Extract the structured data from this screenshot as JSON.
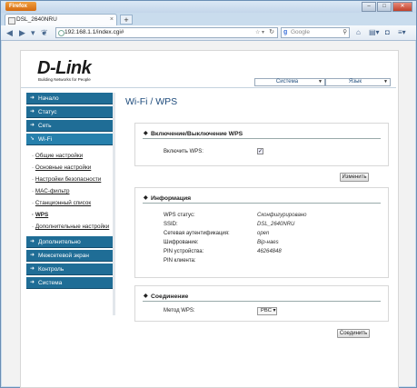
{
  "browser": {
    "app_button": "Firefox",
    "tab_title": "DSL_2640NRU",
    "tab_close": "×",
    "new_tab": "+",
    "url": "192.168.1.1/index.cgi#",
    "search_placeholder": "Google",
    "win_minimize": "–",
    "win_maximize": "□",
    "win_close": "✕"
  },
  "header": {
    "logo_text": "D-Link",
    "logo_tagline": "Building Networks for People",
    "system_select": "Система",
    "language_select": "Язык"
  },
  "sidebar": {
    "items_top": [
      {
        "label": "Начало"
      },
      {
        "label": "Статус"
      },
      {
        "label": "Сеть"
      },
      {
        "label": "Wi-Fi"
      }
    ],
    "wifi_sub": [
      {
        "label": "Общие настройки"
      },
      {
        "label": "Основные настройки"
      },
      {
        "label": "Настройки безопасности"
      },
      {
        "label": "MAC-фильтр"
      },
      {
        "label": "Станционный список"
      },
      {
        "label": "WPS"
      },
      {
        "label": "Дополнительные настройки"
      }
    ],
    "items_bottom": [
      {
        "label": "Дополнительно"
      },
      {
        "label": "Межсетевой экран"
      },
      {
        "label": "Контроль"
      },
      {
        "label": "Система"
      }
    ]
  },
  "main": {
    "title": "Wi-Fi / WPS",
    "enable_section": {
      "heading": "Включение/Выключение WPS",
      "enable_label": "Включить WPS:",
      "enable_checked": true
    },
    "apply_button": "Изменить",
    "info_section": {
      "heading": "Информация",
      "rows": [
        {
          "label": "WPS статус:",
          "value": "Сконфигурировано"
        },
        {
          "label": "SSID:",
          "value": "DSL_2640NRU"
        },
        {
          "label": "Сетевая аутентификация:",
          "value": "open"
        },
        {
          "label": "Шифрование:",
          "value": "Bip-наes"
        },
        {
          "label": "PIN устройства:",
          "value": "46264848"
        },
        {
          "label": "PIN клиента:",
          "value": ""
        }
      ]
    },
    "connect_section": {
      "heading": "Соединение",
      "method_label": "Метод WPS:",
      "method_value": "PBC"
    },
    "connect_button": "Соединить"
  }
}
